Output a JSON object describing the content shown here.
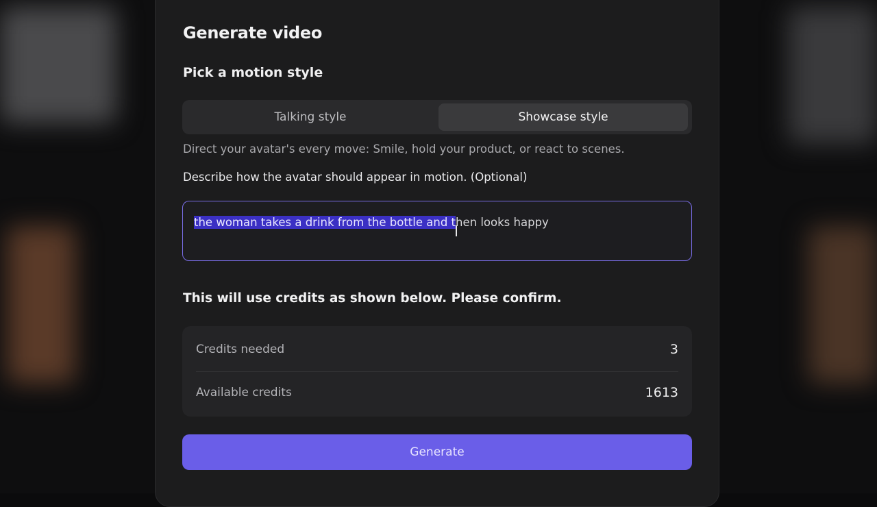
{
  "modal": {
    "title": "Generate video",
    "motion_section_label": "Pick a motion style",
    "motion_styles": [
      {
        "label": "Talking style",
        "selected": false
      },
      {
        "label": "Showcase style",
        "selected": true
      }
    ],
    "hint": "Direct your avatar's every move: Smile, hold your product, or react to scenes.",
    "prompt_label": "Describe how the avatar should appear in motion. (Optional)",
    "prompt_value_selected": "the woman takes a drink from the bottle and t",
    "prompt_value_rest": "hen looks happy",
    "confirm_text": "This will use credits as shown below. Please confirm.",
    "credits": [
      {
        "label": "Credits needed",
        "value": "3"
      },
      {
        "label": "Available credits",
        "value": "1613"
      }
    ],
    "generate_label": "Generate"
  },
  "colors": {
    "accent": "#6a5ee8",
    "selection": "#3b30c4",
    "panel": "#1c1c1d"
  }
}
